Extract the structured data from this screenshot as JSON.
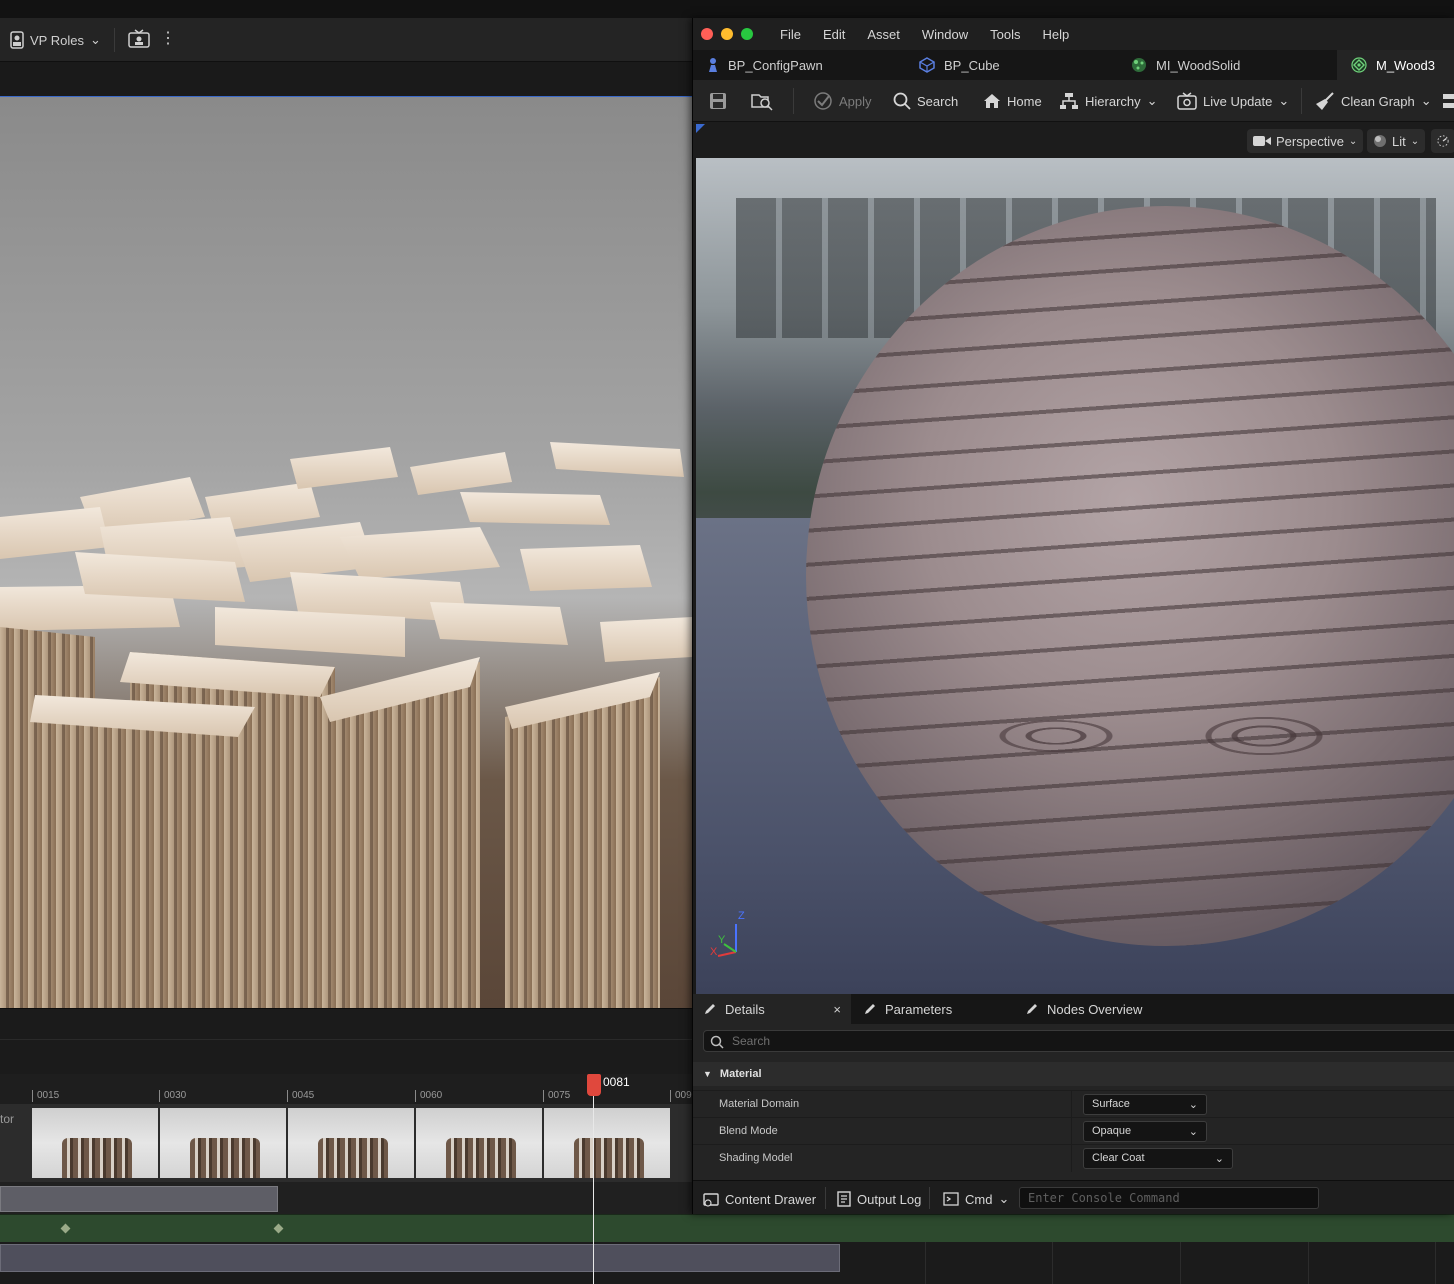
{
  "background_editor": {
    "vp_roles_label": "VP Roles",
    "timeline": {
      "ticks": [
        "0015",
        "0030",
        "0045",
        "0060",
        "0075",
        "009"
      ],
      "playhead_frame": "0081",
      "track_label_partial": "tor"
    }
  },
  "material_editor": {
    "menu": [
      "File",
      "Edit",
      "Asset",
      "Window",
      "Tools",
      "Help"
    ],
    "tabs": [
      {
        "label": "BP_ConfigPawn",
        "icon": "pawn-icon"
      },
      {
        "label": "BP_Cube",
        "icon": "blueprint-icon"
      },
      {
        "label": "MI_WoodSolid",
        "icon": "material-instance-icon"
      },
      {
        "label": "M_Wood3",
        "icon": "material-icon",
        "active": true
      }
    ],
    "toolbar": {
      "apply_label": "Apply",
      "search_label": "Search",
      "home_label": "Home",
      "hierarchy_label": "Hierarchy",
      "live_update_label": "Live Update",
      "clean_graph_label": "Clean Graph"
    },
    "viewport": {
      "perspective_label": "Perspective",
      "lit_label": "Lit",
      "axis_z": "Z",
      "axis_y": "Y",
      "axis_x": "X"
    },
    "panel_tabs": {
      "details_label": "Details",
      "close_glyph": "×",
      "parameters_label": "Parameters",
      "nodes_overview_label": "Nodes Overview"
    },
    "details": {
      "search_placeholder": "Search",
      "category": "Material",
      "rows": [
        {
          "label": "Material Domain",
          "value": "Surface"
        },
        {
          "label": "Blend Mode",
          "value": "Opaque"
        },
        {
          "label": "Shading Model",
          "value": "Clear Coat"
        }
      ]
    },
    "statusbar": {
      "content_drawer_label": "Content Drawer",
      "output_log_label": "Output Log",
      "cmd_label": "Cmd",
      "console_placeholder": "Enter Console Command"
    }
  },
  "colors": {
    "playhead": "#e0483d",
    "traffic_close": "#ff5f57",
    "traffic_min": "#febc2e",
    "traffic_max": "#28c840",
    "keyframe_track": "#2d4a2e"
  }
}
